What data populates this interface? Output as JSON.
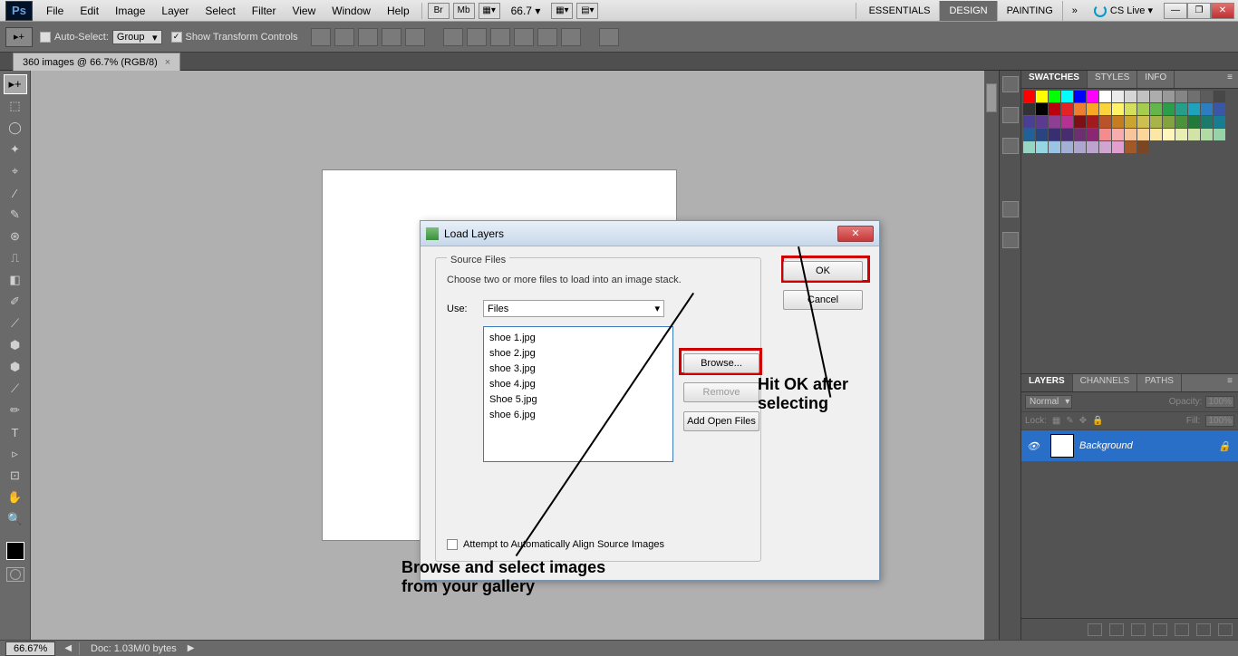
{
  "menu": {
    "items": [
      "File",
      "Edit",
      "Image",
      "Layer",
      "Select",
      "Filter",
      "View",
      "Window",
      "Help"
    ],
    "toolicons": [
      "Br",
      "Mb"
    ],
    "zoom": "66.7 ▾",
    "workspaces": [
      "ESSENTIALS",
      "DESIGN",
      "PAINTING"
    ],
    "workspace_active": 1,
    "more_icon": "»",
    "cslive": "CS Live ▾",
    "winbtns": [
      "—",
      "❐",
      "✕"
    ]
  },
  "options": {
    "tool_label": "▸+",
    "auto_select": "Auto-Select:",
    "group_dropdown": "Group",
    "show_controls": "Show Transform Controls"
  },
  "tab": {
    "title": "360 images @ 66.7% (RGB/8)",
    "close": "×"
  },
  "tools": [
    "▸+",
    "⬚",
    "◯",
    "✦",
    "⌖",
    "∕",
    "✎",
    "⊛",
    "⎍",
    "◧",
    "✐",
    "⟋",
    "⬢",
    "⬢",
    "◉",
    "●",
    "⟋",
    "✏",
    "T",
    "▹",
    "⊡",
    "✋",
    "🔍"
  ],
  "selected_tool": 0,
  "right": {
    "swatch_tabs": [
      "SWATCHES",
      "STYLES",
      "INFO"
    ],
    "swatch_active": 0,
    "midicons": 7,
    "layer_tabs": [
      "LAYERS",
      "CHANNELS",
      "PATHS"
    ],
    "layer_active": 0,
    "blend": "Normal",
    "opacity_lbl": "Opacity:",
    "opacity": "100%",
    "lock_lbl": "Lock:",
    "fill_lbl": "Fill:",
    "fill": "100%",
    "bg_layer": "Background"
  },
  "status": {
    "zoom": "66.67%",
    "doc": "Doc: 1.03M/0 bytes"
  },
  "dialog": {
    "title": "Load Layers",
    "fieldset": "Source Files",
    "help": "Choose two or more files to load into an image stack.",
    "use_label": "Use:",
    "use_value": "Files",
    "files": [
      "shoe 1.jpg",
      "shoe 2.jpg",
      "shoe 3.jpg",
      "shoe 4.jpg",
      "Shoe 5.jpg",
      "shoe 6.jpg"
    ],
    "ok": "OK",
    "cancel": "Cancel",
    "browse": "Browse...",
    "remove": "Remove",
    "add_open": "Add Open Files",
    "checkbox": "Attempt to Automatically Align Source Images"
  },
  "annotations": {
    "ok_note_1": "Hit OK after",
    "ok_note_2": "selecting",
    "browse_note_1": "Browse and select images",
    "browse_note_2": "from your gallery"
  },
  "swatch_colors": [
    "#ff0000",
    "#ffff00",
    "#00ff00",
    "#00ffff",
    "#0000ff",
    "#ff00ff",
    "#ffffff",
    "#ebebeb",
    "#d6d6d6",
    "#c2c2c2",
    "#adadad",
    "#999999",
    "#858585",
    "#707070",
    "#5c5c5c",
    "#474747",
    "#333333",
    "#000000",
    "#b9020d",
    "#e52225",
    "#ee7e2f",
    "#f9a825",
    "#fbd33c",
    "#fff468",
    "#d4e05b",
    "#a6ce4e",
    "#63b74a",
    "#2b9e4b",
    "#249f89",
    "#1fa2bc",
    "#2c7ec1",
    "#3957a6",
    "#4a3f94",
    "#5d3a91",
    "#8d3f94",
    "#b53293",
    "#7c1016",
    "#a21a1d",
    "#ba5328",
    "#c47e1f",
    "#c9a52f",
    "#cdc051",
    "#a8b348",
    "#82a33e",
    "#4d913a",
    "#21793a",
    "#1b7a69",
    "#177d93",
    "#216197",
    "#2a4381",
    "#382f72",
    "#472c70",
    "#6c3072",
    "#8c2672",
    "#f28c8f",
    "#f7adad",
    "#f9c49a",
    "#fcd59a",
    "#fde7a5",
    "#fff6bc",
    "#e8edb1",
    "#d1e4a5",
    "#b1dba5",
    "#96d3a6",
    "#96d5c4",
    "#95d6e3",
    "#9bc3e4",
    "#a3b0d6",
    "#afa6cf",
    "#bba4ce",
    "#d0a6d0",
    "#e39ed0",
    "#a35828",
    "#7a4722"
  ]
}
